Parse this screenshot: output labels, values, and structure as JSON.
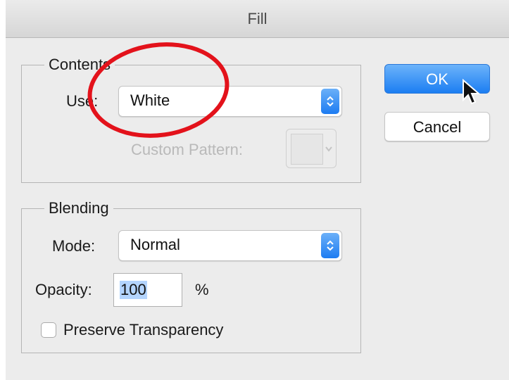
{
  "dialog": {
    "title": "Fill"
  },
  "contents": {
    "legend": "Contents",
    "use_label": "Use:",
    "use_value": "White",
    "custom_pattern_label": "Custom Pattern:"
  },
  "blending": {
    "legend": "Blending",
    "mode_label": "Mode:",
    "mode_value": "Normal",
    "opacity_label": "Opacity:",
    "opacity_value": "100",
    "opacity_unit": "%",
    "preserve_label": "Preserve Transparency",
    "preserve_checked": false
  },
  "buttons": {
    "ok": "OK",
    "cancel": "Cancel"
  },
  "annotation": {
    "color": "#e3121b"
  },
  "colors": {
    "accent": "#1d7cf2"
  }
}
